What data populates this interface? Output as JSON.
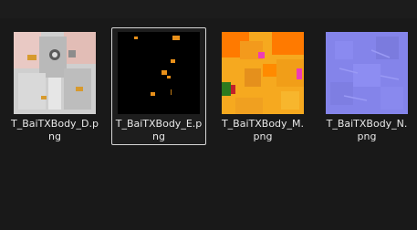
{
  "files": [
    {
      "name_line1": "T_BaiTXBody_D.p",
      "name_line2": "ng",
      "thumb_icon": "diffuse-texture-thumbnail",
      "selected": false
    },
    {
      "name_line1": "T_BaiTXBody_E.p",
      "name_line2": "ng",
      "thumb_icon": "emissive-texture-thumbnail",
      "selected": true
    },
    {
      "name_line1": "T_BaiTXBody_M.",
      "name_line2": "png",
      "thumb_icon": "mask-texture-thumbnail",
      "selected": false
    },
    {
      "name_line1": "T_BaiTXBody_N.",
      "name_line2": "png",
      "thumb_icon": "normal-map-thumbnail",
      "selected": false
    }
  ],
  "colors": {
    "background": "#191919",
    "selection_border": "#d6d6d6",
    "text": "#e8e8e8",
    "normal_map": "#7f7fe6",
    "mask_orange": "#f39a1c",
    "emissive_orange": "#e8901a"
  }
}
